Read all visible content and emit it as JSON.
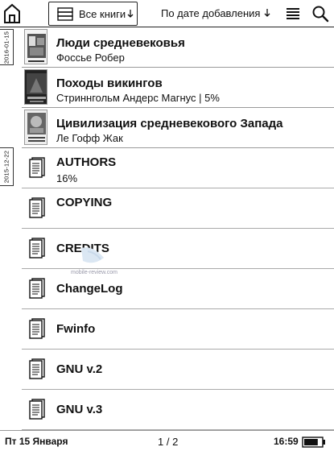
{
  "header": {
    "filter_label": "Все книги",
    "sort_label": "По дате добавления"
  },
  "date_tabs": [
    "2016-01-15",
    "2015-12-22"
  ],
  "books": [
    {
      "title": "Люди средневековья",
      "subtitle": "Фоссье Робер"
    },
    {
      "title": "Походы викингов",
      "subtitle": "Стриннгольм Андерс Магнус | 5%"
    },
    {
      "title": "Цивилизация средневекового Запада",
      "subtitle": "Ле Гофф Жак"
    }
  ],
  "documents": [
    {
      "title": "AUTHORS",
      "subtitle": "16%"
    },
    {
      "title": "COPYING"
    },
    {
      "title": "CREDITS"
    },
    {
      "title": "ChangeLog"
    },
    {
      "title": "Fwinfo"
    },
    {
      "title": "GNU v.2"
    },
    {
      "title": "GNU v.3"
    }
  ],
  "watermark": "mobile-review.com",
  "status": {
    "date": "Пт 15 Января",
    "page": "1 / 2",
    "time": "16:59",
    "battery_level": 0.8
  }
}
